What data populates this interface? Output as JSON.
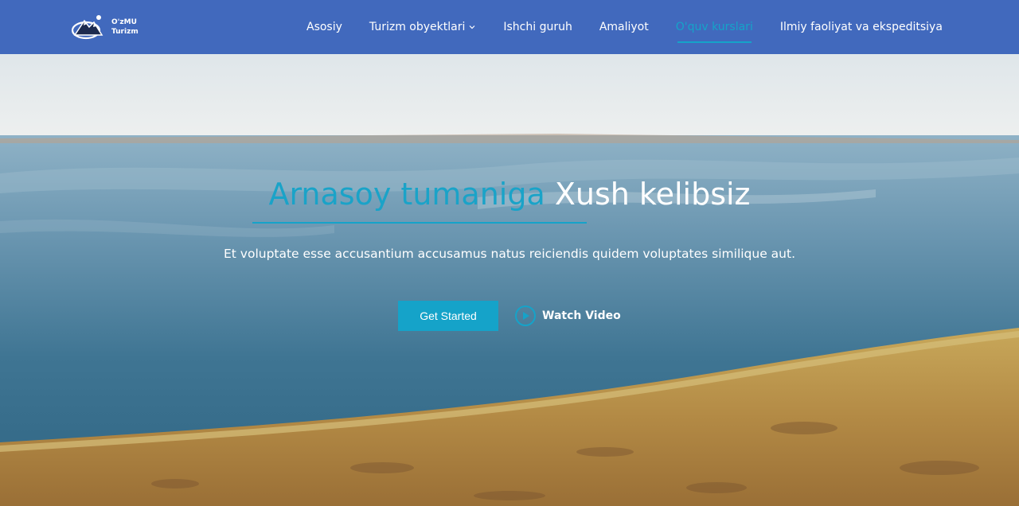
{
  "brand": {
    "line1": "O'zMU",
    "line2": "Turizm"
  },
  "nav": {
    "items": [
      {
        "label": "Asosiy",
        "active": false,
        "dropdown": false
      },
      {
        "label": "Turizm obyektlari",
        "active": false,
        "dropdown": true
      },
      {
        "label": "Ishchi guruh",
        "active": false,
        "dropdown": false
      },
      {
        "label": "Amaliyot",
        "active": false,
        "dropdown": false
      },
      {
        "label": "O'quv kurslari",
        "active": true,
        "dropdown": false
      },
      {
        "label": "Ilmiy faoliyat va ekspeditsiya",
        "active": false,
        "dropdown": false
      }
    ]
  },
  "hero": {
    "title_accent": "Arnasoy tumaniga",
    "title_rest": "Xush kelibsiz",
    "subtitle": "Et voluptate esse accusantium accusamus natus reiciendis quidem voluptates similique aut.",
    "cta_label": "Get Started",
    "video_label": "Watch Video"
  },
  "colors": {
    "header_bg": "#4169bd",
    "accent": "#15a3c9"
  },
  "icons": {
    "logo": "mountain-logo-icon",
    "dropdown": "chevron-down-icon",
    "video": "play-circle-icon"
  }
}
